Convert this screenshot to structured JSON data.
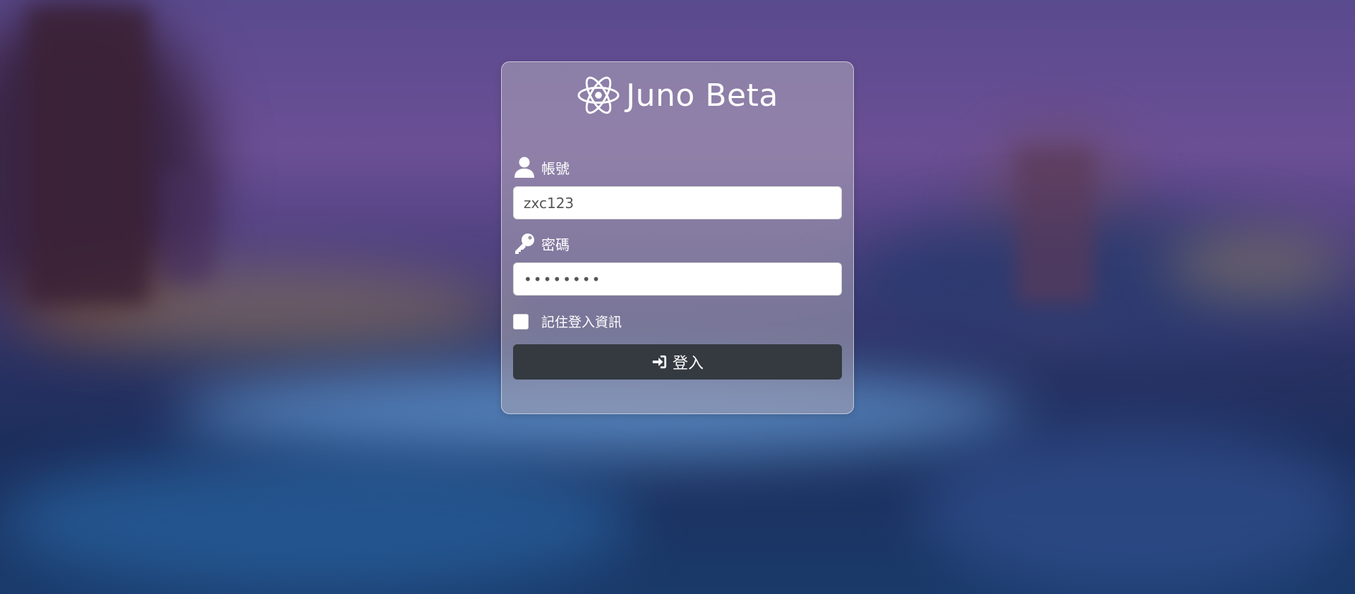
{
  "app": {
    "title": "Juno Beta",
    "icon": "atom-icon"
  },
  "form": {
    "username": {
      "label": "帳號",
      "icon": "user-icon",
      "value": "zxc123"
    },
    "password": {
      "label": "密碼",
      "icon": "key-icon",
      "value": "••••••••"
    },
    "remember": {
      "label": "記住登入資訊",
      "checked": false
    },
    "submit": {
      "label": "登入",
      "icon": "sign-in-icon"
    }
  },
  "colors": {
    "button": "#343a40",
    "card_border": "#e6e6f0"
  }
}
